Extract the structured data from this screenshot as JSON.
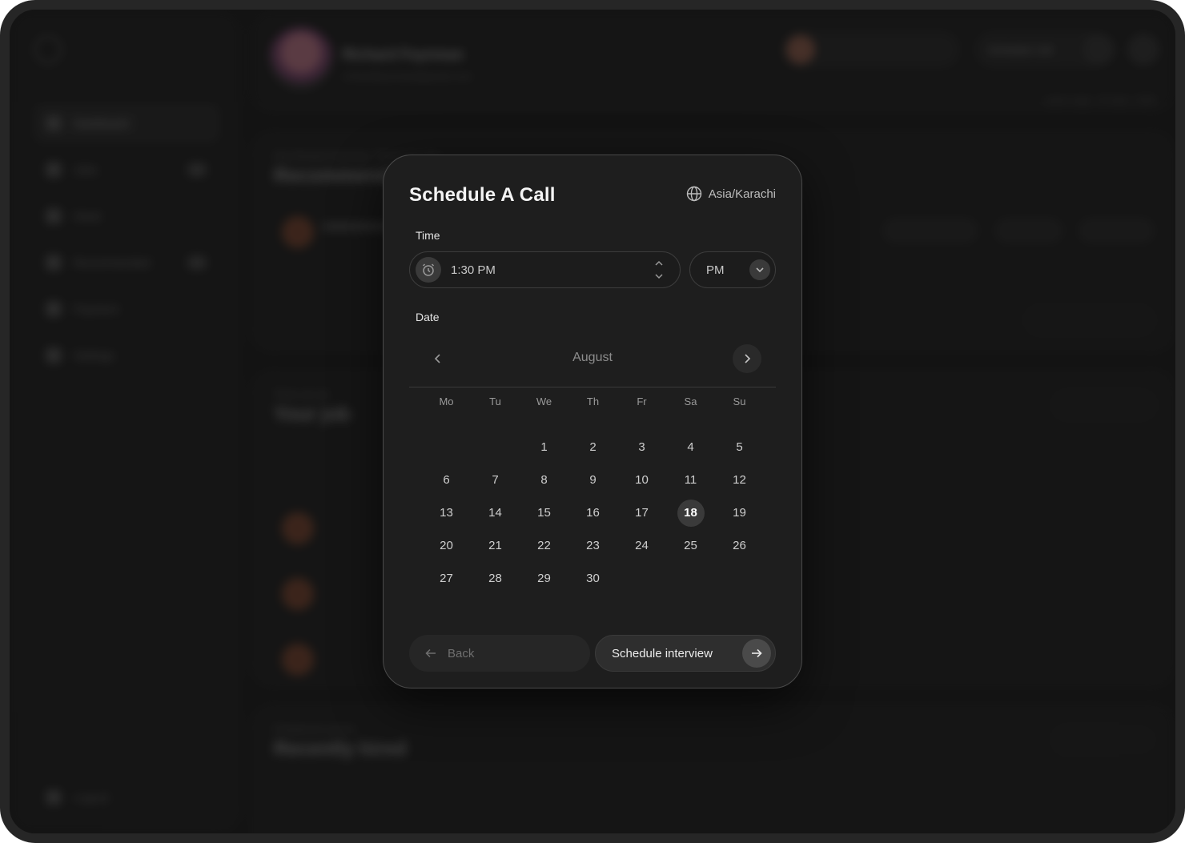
{
  "background": {
    "profile_name": "Richard Feynman",
    "profile_email": "richardfeynman@gmail.com",
    "header_user": "Esther Howard",
    "header_button": "Schedule Call",
    "last_login": "Latest login: 20 April, 2026",
    "nav": [
      "Dashboard",
      "Jobs",
      "Hired",
      "Recommended",
      "Payment",
      "Settings"
    ],
    "logout": "Logout",
    "cards": {
      "recommended_sub": "Hey Richard Feynman, Thank you very",
      "recommended_title": "Recommended",
      "jobs_sub": "There are all",
      "jobs_title": "Your job",
      "hired_sub": "Freelancers you've",
      "hired_title": "Recently hired"
    }
  },
  "modal": {
    "title": "Schedule A Call",
    "timezone": "Asia/Karachi",
    "time_label": "Time",
    "time_value": "1:30 PM",
    "ampm_value": "PM",
    "date_label": "Date",
    "calendar": {
      "month": "August",
      "weekdays": [
        "Mo",
        "Tu",
        "We",
        "Th",
        "Fr",
        "Sa",
        "Su"
      ],
      "leading_blanks": 2,
      "days_in_month": 30,
      "selected_day": 18
    },
    "back_label": "Back",
    "schedule_label": "Schedule interview"
  }
}
